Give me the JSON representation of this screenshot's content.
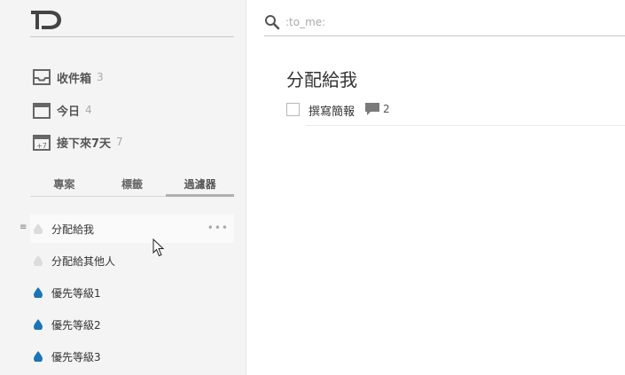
{
  "app": {
    "logo_text": "TD"
  },
  "search": {
    "placeholder": ":to_me:",
    "value": ""
  },
  "nav": [
    {
      "label": "收件箱",
      "count": "3",
      "icon": "inbox-icon"
    },
    {
      "label": "今日",
      "count": "4",
      "icon": "calendar-icon"
    },
    {
      "label": "接下來7天",
      "count": "7",
      "icon": "calendar-plus7-icon",
      "icon_text": "+7"
    }
  ],
  "tabs": [
    {
      "label": "專案",
      "active": false
    },
    {
      "label": "標籤",
      "active": false
    },
    {
      "label": "過濾器",
      "active": true
    }
  ],
  "filters": [
    {
      "label": "分配給我",
      "color": "#dcdcdc",
      "hover": true
    },
    {
      "label": "分配給其他人",
      "color": "#dcdcdc",
      "hover": false
    },
    {
      "label": "優先等級1",
      "color": "#1b74b8",
      "hover": false
    },
    {
      "label": "優先等級2",
      "color": "#1b74b8",
      "hover": false
    },
    {
      "label": "優先等級3",
      "color": "#1b74b8",
      "hover": false
    }
  ],
  "main": {
    "title": "分配給我",
    "tasks": [
      {
        "label": "撰寫簡報",
        "comments": "2"
      }
    ]
  }
}
